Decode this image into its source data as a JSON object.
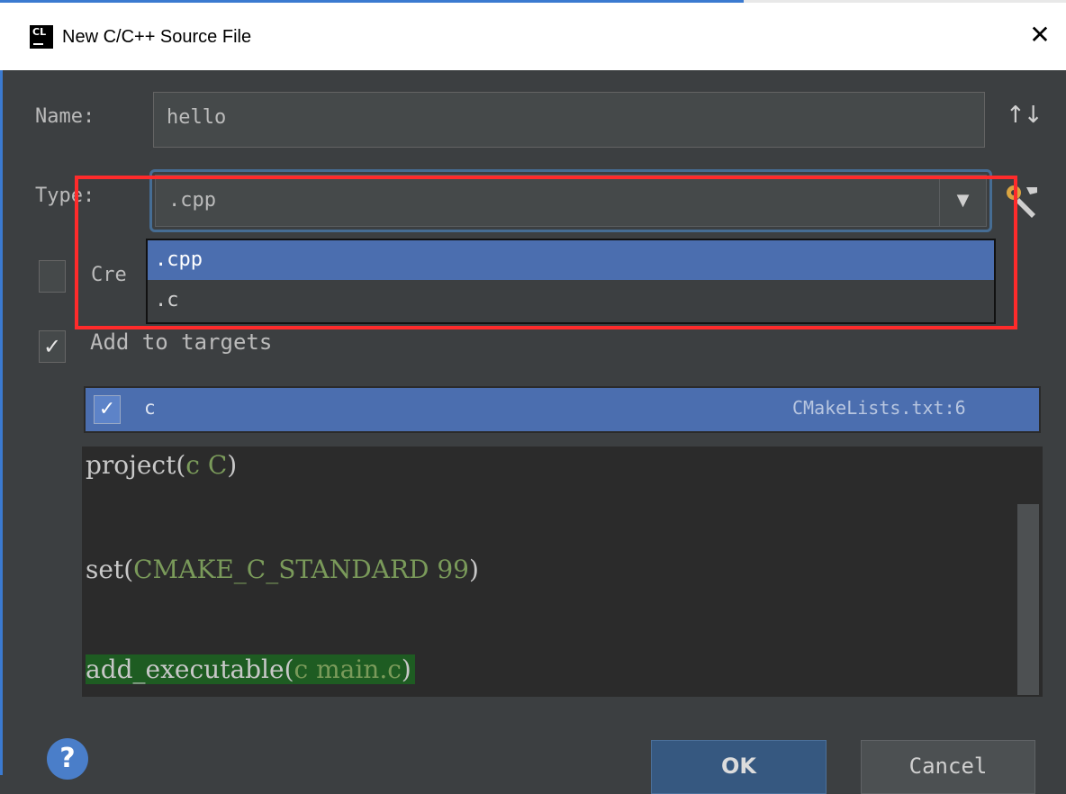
{
  "window": {
    "title": "New C/C++ Source File",
    "app_icon_text": "CL",
    "close_glyph": "✕"
  },
  "form": {
    "name_label": "Name:",
    "name_value": "hello",
    "sort_icon": "↑↓",
    "type_label": "Type:",
    "type_value": ".cpp",
    "dropdown_arrow": "▼",
    "create_label": "Cre",
    "type_options": [
      ".cpp",
      ".c"
    ],
    "add_to_targets_label": "Add to targets",
    "add_to_targets_checked": true
  },
  "targets": [
    {
      "name": "c",
      "file": "CMakeLists.txt:6",
      "checked": true
    }
  ],
  "code_preview": {
    "lines": [
      {
        "func": "project(",
        "args": "c C",
        "close": ")"
      },
      {
        "func": "set(",
        "args": "CMAKE_C_STANDARD 99",
        "close": ")"
      },
      {
        "func": "add_executable(",
        "args": "c main.c",
        "close": ")"
      }
    ]
  },
  "buttons": {
    "help": "?",
    "ok": "OK",
    "cancel": "Cancel"
  },
  "colors": {
    "background": "#3c3f41",
    "selection": "#4b6eaf",
    "highlight_annotation": "#ff2b2b",
    "code_highlight": "#1e5c22"
  },
  "icons": {
    "app": "clion-app-icon",
    "close": "close-icon",
    "sort": "sort-icon",
    "dropdown": "chevron-down-icon",
    "settings": "wrench-icon",
    "help": "help-icon"
  }
}
